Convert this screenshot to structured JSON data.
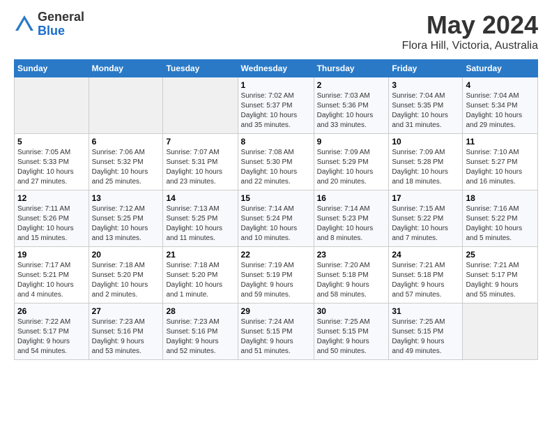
{
  "logo": {
    "general": "General",
    "blue": "Blue"
  },
  "title": "May 2024",
  "subtitle": "Flora Hill, Victoria, Australia",
  "days_header": [
    "Sunday",
    "Monday",
    "Tuesday",
    "Wednesday",
    "Thursday",
    "Friday",
    "Saturday"
  ],
  "weeks": [
    [
      {
        "day": "",
        "info": ""
      },
      {
        "day": "",
        "info": ""
      },
      {
        "day": "",
        "info": ""
      },
      {
        "day": "1",
        "info": "Sunrise: 7:02 AM\nSunset: 5:37 PM\nDaylight: 10 hours\nand 35 minutes."
      },
      {
        "day": "2",
        "info": "Sunrise: 7:03 AM\nSunset: 5:36 PM\nDaylight: 10 hours\nand 33 minutes."
      },
      {
        "day": "3",
        "info": "Sunrise: 7:04 AM\nSunset: 5:35 PM\nDaylight: 10 hours\nand 31 minutes."
      },
      {
        "day": "4",
        "info": "Sunrise: 7:04 AM\nSunset: 5:34 PM\nDaylight: 10 hours\nand 29 minutes."
      }
    ],
    [
      {
        "day": "5",
        "info": "Sunrise: 7:05 AM\nSunset: 5:33 PM\nDaylight: 10 hours\nand 27 minutes."
      },
      {
        "day": "6",
        "info": "Sunrise: 7:06 AM\nSunset: 5:32 PM\nDaylight: 10 hours\nand 25 minutes."
      },
      {
        "day": "7",
        "info": "Sunrise: 7:07 AM\nSunset: 5:31 PM\nDaylight: 10 hours\nand 23 minutes."
      },
      {
        "day": "8",
        "info": "Sunrise: 7:08 AM\nSunset: 5:30 PM\nDaylight: 10 hours\nand 22 minutes."
      },
      {
        "day": "9",
        "info": "Sunrise: 7:09 AM\nSunset: 5:29 PM\nDaylight: 10 hours\nand 20 minutes."
      },
      {
        "day": "10",
        "info": "Sunrise: 7:09 AM\nSunset: 5:28 PM\nDaylight: 10 hours\nand 18 minutes."
      },
      {
        "day": "11",
        "info": "Sunrise: 7:10 AM\nSunset: 5:27 PM\nDaylight: 10 hours\nand 16 minutes."
      }
    ],
    [
      {
        "day": "12",
        "info": "Sunrise: 7:11 AM\nSunset: 5:26 PM\nDaylight: 10 hours\nand 15 minutes."
      },
      {
        "day": "13",
        "info": "Sunrise: 7:12 AM\nSunset: 5:25 PM\nDaylight: 10 hours\nand 13 minutes."
      },
      {
        "day": "14",
        "info": "Sunrise: 7:13 AM\nSunset: 5:25 PM\nDaylight: 10 hours\nand 11 minutes."
      },
      {
        "day": "15",
        "info": "Sunrise: 7:14 AM\nSunset: 5:24 PM\nDaylight: 10 hours\nand 10 minutes."
      },
      {
        "day": "16",
        "info": "Sunrise: 7:14 AM\nSunset: 5:23 PM\nDaylight: 10 hours\nand 8 minutes."
      },
      {
        "day": "17",
        "info": "Sunrise: 7:15 AM\nSunset: 5:22 PM\nDaylight: 10 hours\nand 7 minutes."
      },
      {
        "day": "18",
        "info": "Sunrise: 7:16 AM\nSunset: 5:22 PM\nDaylight: 10 hours\nand 5 minutes."
      }
    ],
    [
      {
        "day": "19",
        "info": "Sunrise: 7:17 AM\nSunset: 5:21 PM\nDaylight: 10 hours\nand 4 minutes."
      },
      {
        "day": "20",
        "info": "Sunrise: 7:18 AM\nSunset: 5:20 PM\nDaylight: 10 hours\nand 2 minutes."
      },
      {
        "day": "21",
        "info": "Sunrise: 7:18 AM\nSunset: 5:20 PM\nDaylight: 10 hours\nand 1 minute."
      },
      {
        "day": "22",
        "info": "Sunrise: 7:19 AM\nSunset: 5:19 PM\nDaylight: 9 hours\nand 59 minutes."
      },
      {
        "day": "23",
        "info": "Sunrise: 7:20 AM\nSunset: 5:18 PM\nDaylight: 9 hours\nand 58 minutes."
      },
      {
        "day": "24",
        "info": "Sunrise: 7:21 AM\nSunset: 5:18 PM\nDaylight: 9 hours\nand 57 minutes."
      },
      {
        "day": "25",
        "info": "Sunrise: 7:21 AM\nSunset: 5:17 PM\nDaylight: 9 hours\nand 55 minutes."
      }
    ],
    [
      {
        "day": "26",
        "info": "Sunrise: 7:22 AM\nSunset: 5:17 PM\nDaylight: 9 hours\nand 54 minutes."
      },
      {
        "day": "27",
        "info": "Sunrise: 7:23 AM\nSunset: 5:16 PM\nDaylight: 9 hours\nand 53 minutes."
      },
      {
        "day": "28",
        "info": "Sunrise: 7:23 AM\nSunset: 5:16 PM\nDaylight: 9 hours\nand 52 minutes."
      },
      {
        "day": "29",
        "info": "Sunrise: 7:24 AM\nSunset: 5:15 PM\nDaylight: 9 hours\nand 51 minutes."
      },
      {
        "day": "30",
        "info": "Sunrise: 7:25 AM\nSunset: 5:15 PM\nDaylight: 9 hours\nand 50 minutes."
      },
      {
        "day": "31",
        "info": "Sunrise: 7:25 AM\nSunset: 5:15 PM\nDaylight: 9 hours\nand 49 minutes."
      },
      {
        "day": "",
        "info": ""
      }
    ]
  ]
}
